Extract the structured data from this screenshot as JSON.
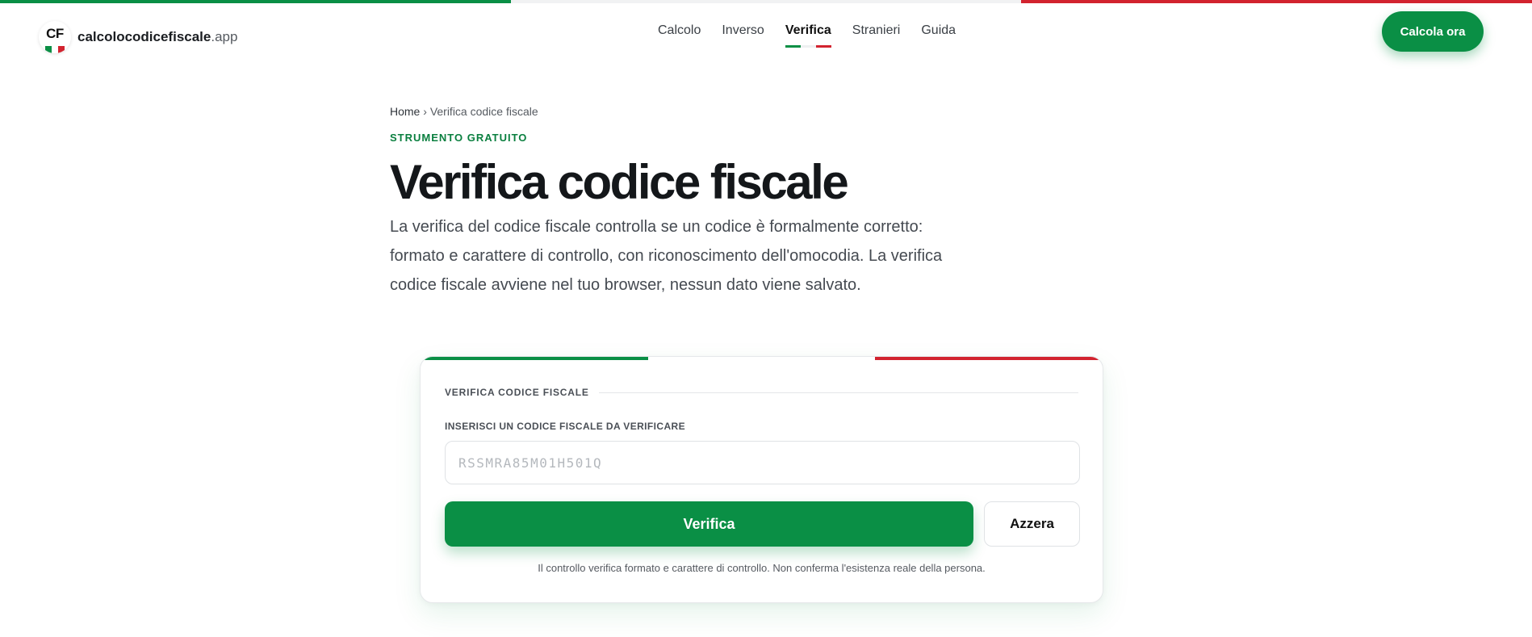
{
  "colors": {
    "green": "#0a8f45",
    "white": "#f1f2f3",
    "red": "#d2232f",
    "text": "#14171a"
  },
  "brand": {
    "logo_text": "CF",
    "name": "calcolocodicefiscale",
    "tld": ".app"
  },
  "nav": {
    "items": [
      {
        "label": "Calcolo"
      },
      {
        "label": "Inverso"
      },
      {
        "label": "Verifica",
        "active": true
      },
      {
        "label": "Stranieri"
      },
      {
        "label": "Guida"
      }
    ]
  },
  "header": {
    "cta_label": "Calcola ora"
  },
  "breadcrumb": {
    "home": "Home",
    "separator": " › ",
    "current": "Verifica codice fiscale"
  },
  "hero": {
    "eyebrow": "STRUMENTO GRATUITO",
    "title": "Verifica codice fiscale",
    "lead": "La verifica del codice fiscale controlla se un codice è formalmente corretto: formato e carattere di controllo, con riconoscimento dell'omocodia. La verifica codice fiscale avviene nel tuo browser, nessun dato viene salvato."
  },
  "card": {
    "title": "VERIFICA CODICE FISCALE",
    "field_label": "INSERISCI UN CODICE FISCALE DA VERIFICARE",
    "input_value": "",
    "input_placeholder": "RSSMRA85M01H501Q",
    "verify_label": "Verifica",
    "reset_label": "Azzera",
    "note": "Il controllo verifica formato e carattere di controllo. Non conferma l'esistenza reale della persona."
  }
}
